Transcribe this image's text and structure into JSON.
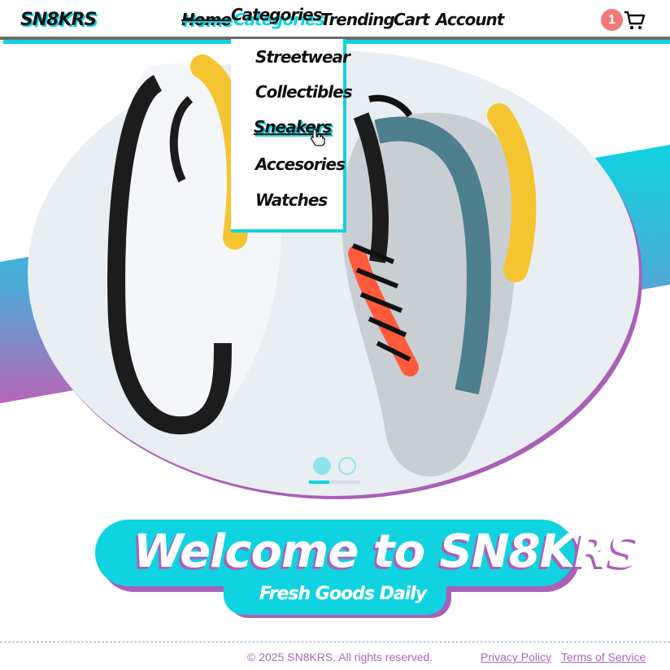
{
  "header": {
    "logo": "SN8KRS",
    "nav": {
      "home": "Home",
      "categories": "Categories",
      "trending": "Trending",
      "cart": "Cart",
      "account": "Account"
    },
    "cart_count": "1",
    "cart_icon": "shopping-cart-icon"
  },
  "dropdown": {
    "items": [
      "Streetwear",
      "Collectibles",
      "Sneakers",
      "Accesories",
      "Watches"
    ],
    "hovered": "Sneakers"
  },
  "hero": {
    "image": "sneakers-photo",
    "carousel_active_index": 0,
    "carousel_slides": 2,
    "progress": 0.4
  },
  "banner": {
    "title": "Welcome to SN8KRS",
    "tagline": "Fresh Goods Daily"
  },
  "footer": {
    "copyright": "© 2025 SN8KRS. All rights reserved.",
    "privacy": "Privacy Policy",
    "terms": "Terms of Service"
  },
  "colors": {
    "accent_cyan": "#0fd3e0",
    "accent_purple": "#a960b8",
    "badge": "#f07a78"
  }
}
